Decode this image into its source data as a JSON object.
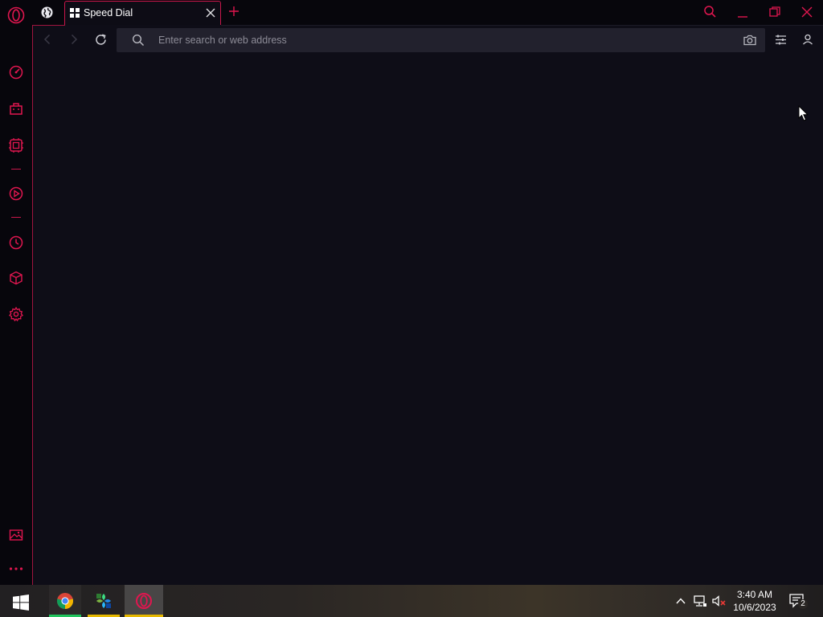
{
  "tab": {
    "title": "Speed Dial"
  },
  "address_bar": {
    "placeholder": "Enter search or web address",
    "value": ""
  },
  "sidebar": {
    "items": [
      {
        "name": "speed-dial",
        "icon": "speedometer-icon"
      },
      {
        "name": "shopping",
        "icon": "shopping-bag-icon"
      },
      {
        "name": "gx-corner",
        "icon": "gx-corner-icon"
      },
      {
        "name": "player",
        "icon": "play-circle-icon"
      },
      {
        "name": "history",
        "icon": "clock-icon"
      },
      {
        "name": "extensions",
        "icon": "cube-icon"
      },
      {
        "name": "settings",
        "icon": "gear-icon"
      },
      {
        "name": "wallpaper",
        "icon": "image-icon"
      },
      {
        "name": "more",
        "icon": "more-dots-icon"
      }
    ]
  },
  "taskbar": {
    "apps": [
      {
        "name": "Google Chrome",
        "icon": "chrome-icon"
      },
      {
        "name": "Explorer",
        "icon": "explorer-icon"
      },
      {
        "name": "Opera GX",
        "icon": "opera-icon"
      }
    ],
    "clock": {
      "time": "3:40 AM",
      "date": "10/6/2023"
    },
    "notification_count": "2"
  },
  "colors": {
    "accent": "#e0164f",
    "background": "#0e0d17",
    "sidebar": "#07060c",
    "address_bar": "#22212d"
  }
}
